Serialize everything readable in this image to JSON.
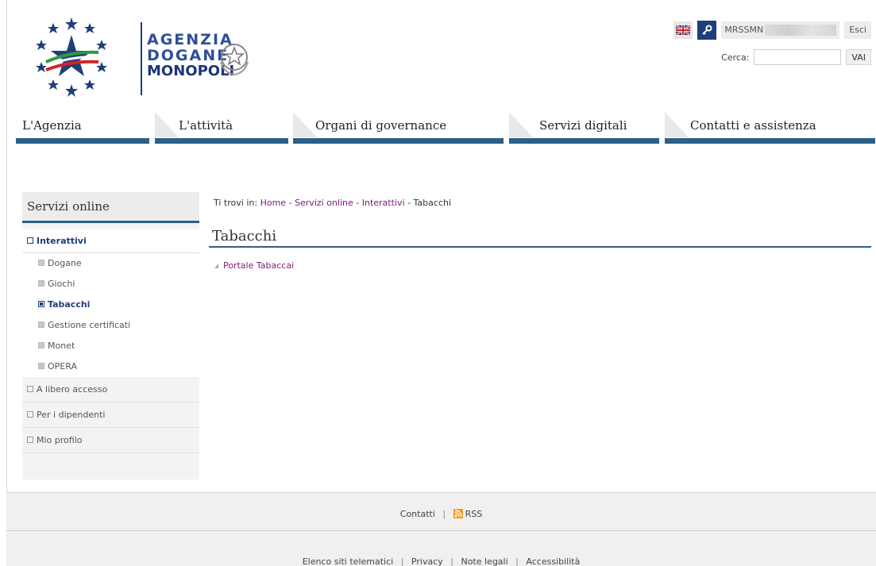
{
  "header": {
    "logo_line1": "AGENZIA",
    "logo_line2": "DOGANE",
    "logo_line3": "MONOPOLI",
    "user_code": "MRSSMN",
    "logout_label": "Esci",
    "search_label": "Cerca:",
    "search_button": "VAI"
  },
  "nav": {
    "items": [
      {
        "label": "L'Agenzia"
      },
      {
        "label": "L'attività"
      },
      {
        "label": "Organi di governance"
      },
      {
        "label": "Servizi digitali"
      },
      {
        "label": "Contatti e assistenza"
      }
    ]
  },
  "sidebar": {
    "title": "Servizi online",
    "active_category": "Interattivi",
    "sub_items": [
      "Dogane",
      "Giochi",
      "Tabacchi",
      "Gestione certificati",
      "Monet",
      "OPERA"
    ],
    "current_sub": "Tabacchi",
    "categories": [
      "A libero accesso",
      "Per i dipendenti",
      "Mio profilo"
    ]
  },
  "breadcrumb": {
    "prefix": "Ti trovi in:",
    "home": "Home",
    "servizi": "Servizi online",
    "interattivi": "Interattivi",
    "current": "Tabacchi",
    "sep": "-"
  },
  "content": {
    "title": "Tabacchi",
    "link": "Portale Tabaccai"
  },
  "footer": {
    "contatti": "Contatti",
    "rss": "RSS",
    "sep": "|",
    "bottom_links": [
      "Elenco siti telematici",
      "Privacy",
      "Note legali",
      "Accessibilità"
    ]
  },
  "colors": {
    "brand_blue": "#1f3e7a",
    "nav_bar": "#2e5f86",
    "link_purple": "#7a1a7a",
    "rss_orange": "#f39a1e"
  }
}
